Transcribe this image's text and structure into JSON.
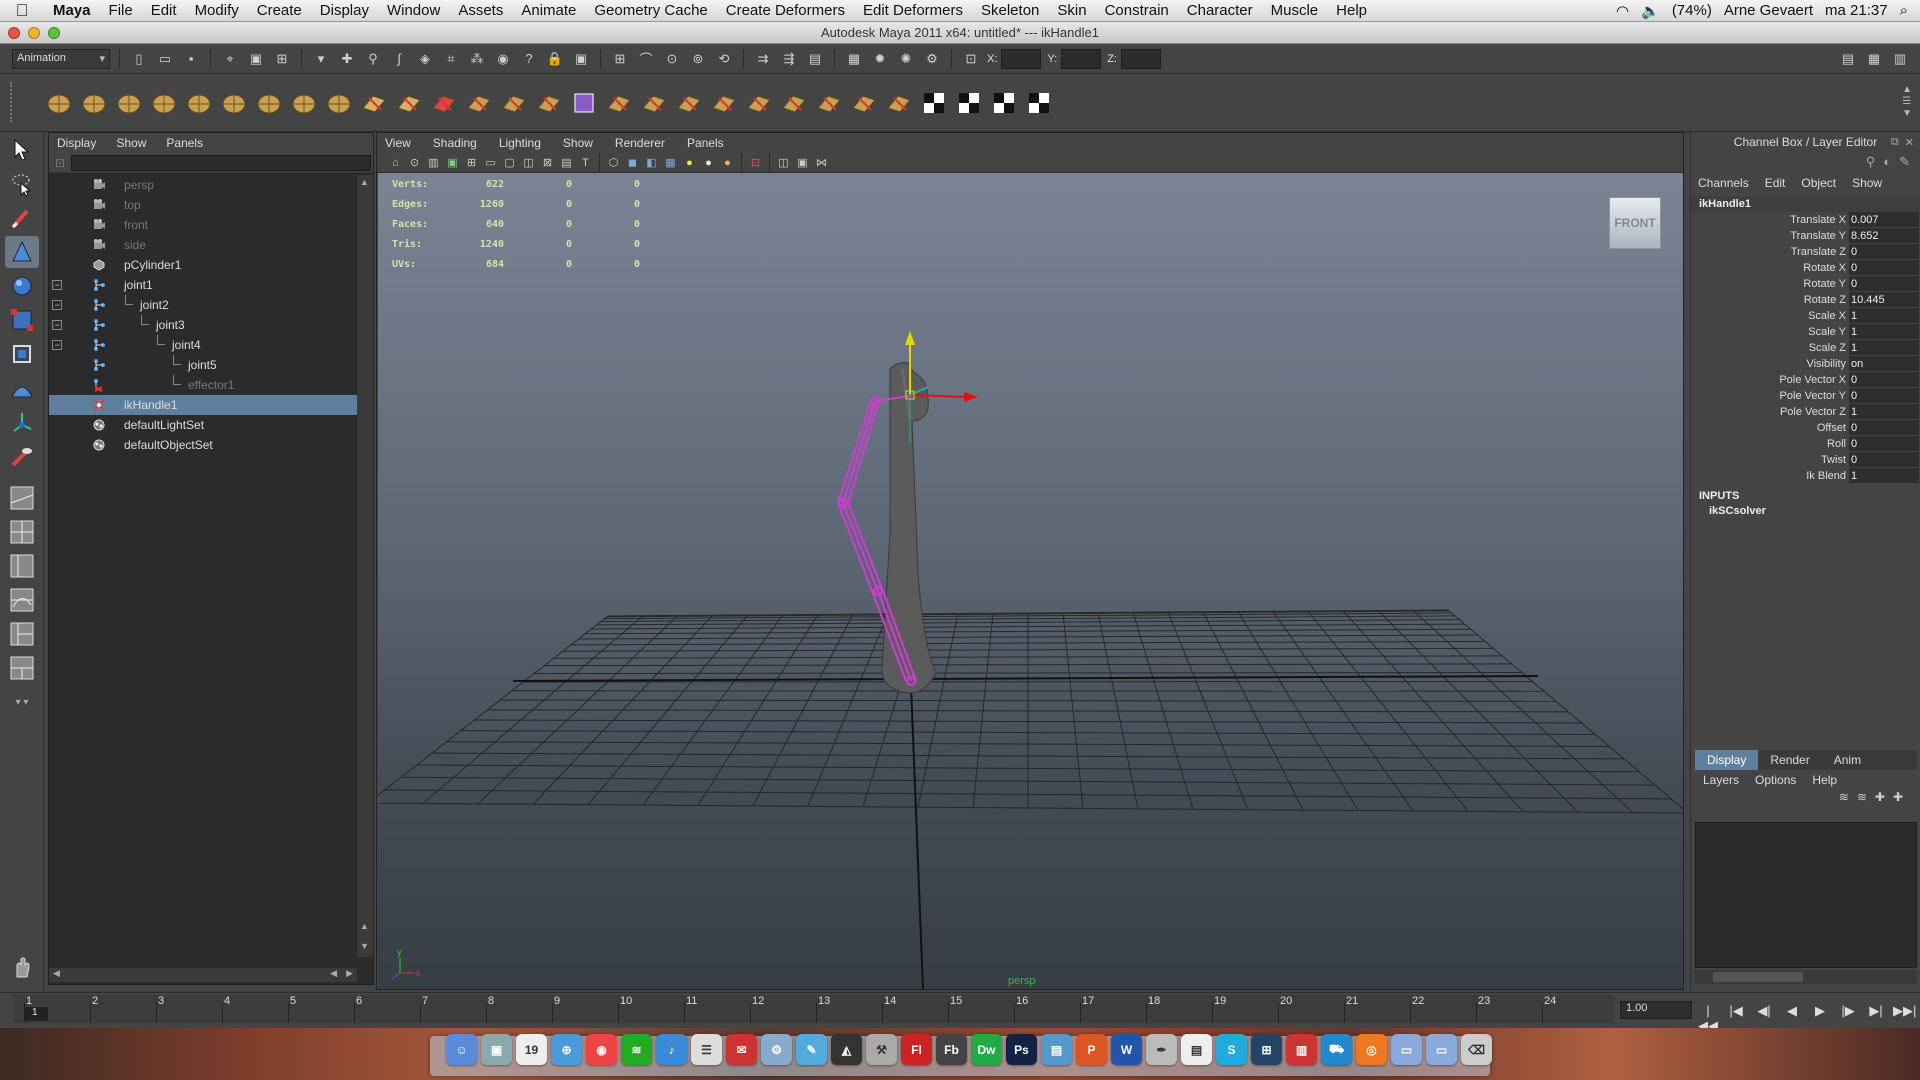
{
  "mac_menubar": {
    "app_name": "Maya",
    "menus": [
      "File",
      "Edit",
      "Modify",
      "Create",
      "Display",
      "Window",
      "Assets",
      "Animate",
      "Geometry Cache",
      "Create Deformers",
      "Edit Deformers",
      "Skeleton",
      "Skin",
      "Constrain",
      "Character",
      "Muscle",
      "Help"
    ],
    "battery": "(74%)",
    "user": "Arne Gevaert",
    "clock": "ma 21:37"
  },
  "window": {
    "title": "Autodesk Maya 2011 x64: untitled*   ---   ikHandle1"
  },
  "statusline": {
    "menu_set": "Animation",
    "x_label": "X:",
    "y_label": "Y:",
    "z_label": "Z:"
  },
  "outliner": {
    "menus": [
      "Display",
      "Show",
      "Panels"
    ],
    "items": [
      {
        "label": "persp",
        "dim": true,
        "icon": "camera-icon",
        "depth": 0
      },
      {
        "label": "top",
        "dim": true,
        "icon": "camera-icon",
        "depth": 0
      },
      {
        "label": "front",
        "dim": true,
        "icon": "camera-icon",
        "depth": 0
      },
      {
        "label": "side",
        "dim": true,
        "icon": "camera-icon",
        "depth": 0
      },
      {
        "label": "pCylinder1",
        "dim": false,
        "icon": "mesh-icon",
        "depth": 0
      },
      {
        "label": "joint1",
        "dim": false,
        "icon": "joint-icon",
        "depth": 0,
        "expand": "−"
      },
      {
        "label": "joint2",
        "dim": false,
        "icon": "joint-icon",
        "depth": 1,
        "expand": "−"
      },
      {
        "label": "joint3",
        "dim": false,
        "icon": "joint-icon",
        "depth": 2,
        "expand": "−"
      },
      {
        "label": "joint4",
        "dim": false,
        "icon": "joint-icon",
        "depth": 3,
        "expand": "−"
      },
      {
        "label": "joint5",
        "dim": false,
        "icon": "joint-icon",
        "depth": 4
      },
      {
        "label": "effector1",
        "dim": true,
        "icon": "effector-icon",
        "depth": 4
      },
      {
        "label": "ikHandle1",
        "dim": false,
        "icon": "ik-handle-icon",
        "depth": 0,
        "selected": true
      },
      {
        "label": "defaultLightSet",
        "dim": false,
        "icon": "set-icon",
        "depth": 0
      },
      {
        "label": "defaultObjectSet",
        "dim": false,
        "icon": "set-icon",
        "depth": 0
      }
    ]
  },
  "viewport": {
    "menus": [
      "View",
      "Shading",
      "Lighting",
      "Show",
      "Renderer",
      "Panels"
    ],
    "hud": [
      {
        "label": "Verts:",
        "v1": "622",
        "v2": "0",
        "v3": "0"
      },
      {
        "label": "Edges:",
        "v1": "1260",
        "v2": "0",
        "v3": "0"
      },
      {
        "label": "Faces:",
        "v1": "640",
        "v2": "0",
        "v3": "0"
      },
      {
        "label": "Tris:",
        "v1": "1240",
        "v2": "0",
        "v3": "0"
      },
      {
        "label": "UVs:",
        "v1": "684",
        "v2": "0",
        "v3": "0"
      }
    ],
    "view_cube_label": "FRONT",
    "camera_label": "persp"
  },
  "channel_box": {
    "header": "Channel Box / Layer Editor",
    "menus": [
      "Channels",
      "Edit",
      "Object",
      "Show"
    ],
    "object": "ikHandle1",
    "attributes": [
      {
        "name": "Translate X",
        "value": "0.007"
      },
      {
        "name": "Translate Y",
        "value": "8.652"
      },
      {
        "name": "Translate Z",
        "value": "0"
      },
      {
        "name": "Rotate X",
        "value": "0"
      },
      {
        "name": "Rotate Y",
        "value": "0"
      },
      {
        "name": "Rotate Z",
        "value": "10.445"
      },
      {
        "name": "Scale X",
        "value": "1"
      },
      {
        "name": "Scale Y",
        "value": "1"
      },
      {
        "name": "Scale Z",
        "value": "1"
      },
      {
        "name": "Visibility",
        "value": "on"
      },
      {
        "name": "Pole Vector X",
        "value": "0"
      },
      {
        "name": "Pole Vector Y",
        "value": "0"
      },
      {
        "name": "Pole Vector Z",
        "value": "1"
      },
      {
        "name": "Offset",
        "value": "0"
      },
      {
        "name": "Roll",
        "value": "0"
      },
      {
        "name": "Twist",
        "value": "0"
      },
      {
        "name": "Ik Blend",
        "value": "1"
      }
    ],
    "inputs_label": "INPUTS",
    "solver": "ikSCsolver"
  },
  "layer_editor": {
    "tabs": [
      "Display",
      "Render",
      "Anim"
    ],
    "active_tab": "Display",
    "menus": [
      "Layers",
      "Options",
      "Help"
    ]
  },
  "timeline": {
    "frames": [
      "1",
      "2",
      "3",
      "4",
      "5",
      "6",
      "7",
      "8",
      "9",
      "10",
      "11",
      "12",
      "13",
      "14",
      "15",
      "16",
      "17",
      "18",
      "19",
      "20",
      "21",
      "22",
      "23",
      "24"
    ],
    "current_frame": "1",
    "playback_value": "1.00"
  },
  "colors": {
    "selection": "#5f7f9f",
    "joint_color": "#d33ad8",
    "hud_text": "#d8e2a8"
  }
}
